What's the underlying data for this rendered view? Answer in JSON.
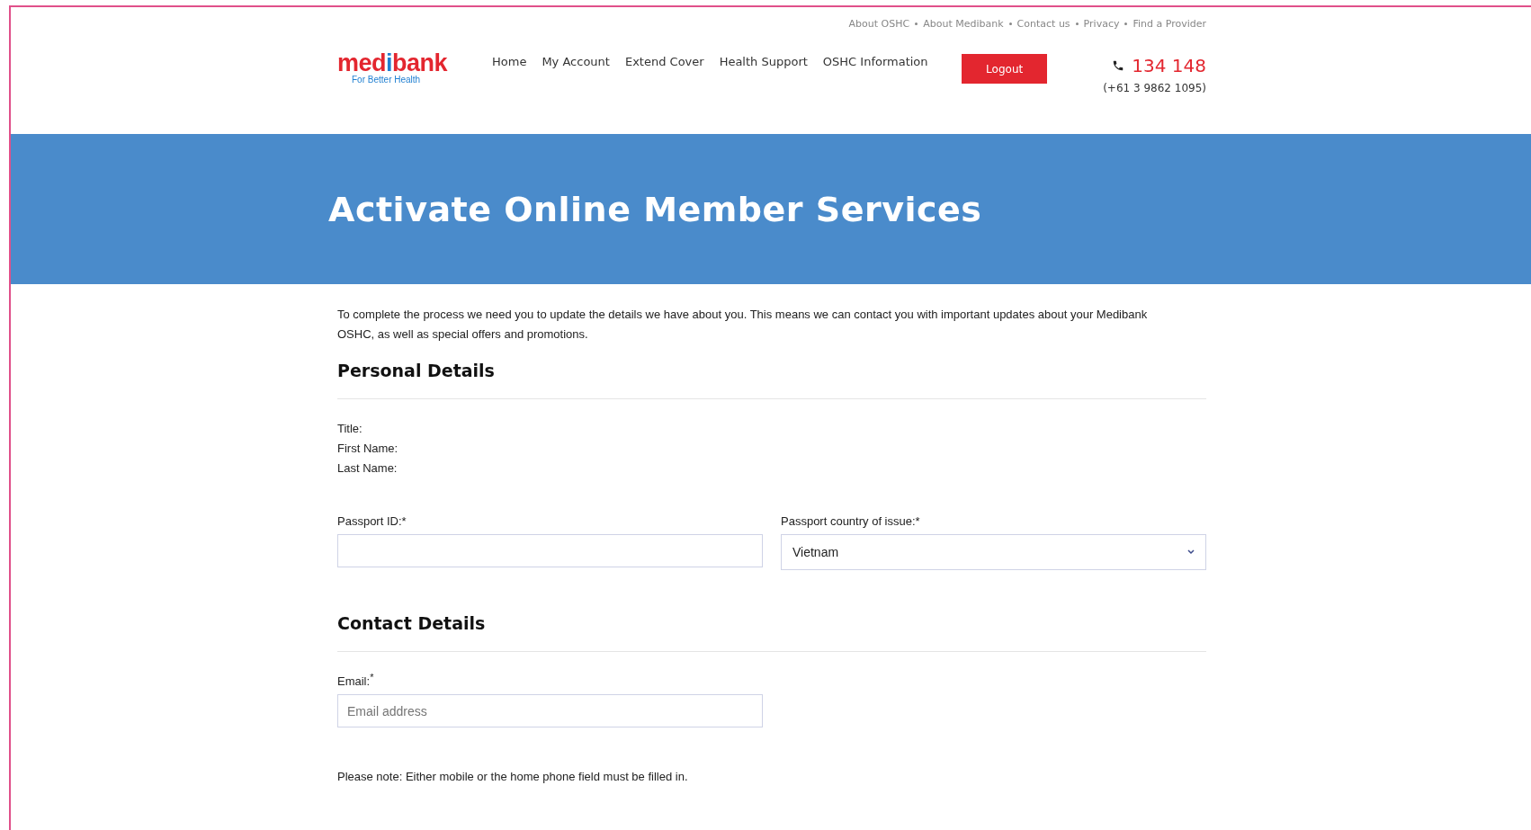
{
  "top_links": [
    "About OSHC",
    "About Medibank",
    "Contact us",
    "Privacy",
    "Find a Provider"
  ],
  "logo": {
    "parts": [
      "med",
      "i",
      "bank"
    ],
    "tagline": "For Better Health"
  },
  "nav": [
    "Home",
    "My Account",
    "Extend Cover",
    "Health Support",
    "OSHC Information"
  ],
  "logout": "Logout",
  "phone": {
    "number": "134 148",
    "international": "(+61 3 9862 1095)"
  },
  "banner": {
    "title": "Activate Online Member Services"
  },
  "intro": "To complete the process we need you to update the details we have about you. This means we can contact you with important updates about your Medibank OSHC, as well as special offers and promotions.",
  "personal": {
    "heading": "Personal Details",
    "labels": [
      "Title:",
      "First Name:",
      "Last Name:"
    ],
    "fields": [
      {
        "kind": "input",
        "label": "Passport ID:*"
      },
      {
        "kind": "select",
        "label": "Passport country of issue:*",
        "value": "Vietnam"
      }
    ]
  },
  "contact": {
    "heading": "Contact Details",
    "email_label": "Email:$^{*}$",
    "email_placeholder": "Email address",
    "note": "Please note: Either mobile or the home phone field must be filled in."
  }
}
